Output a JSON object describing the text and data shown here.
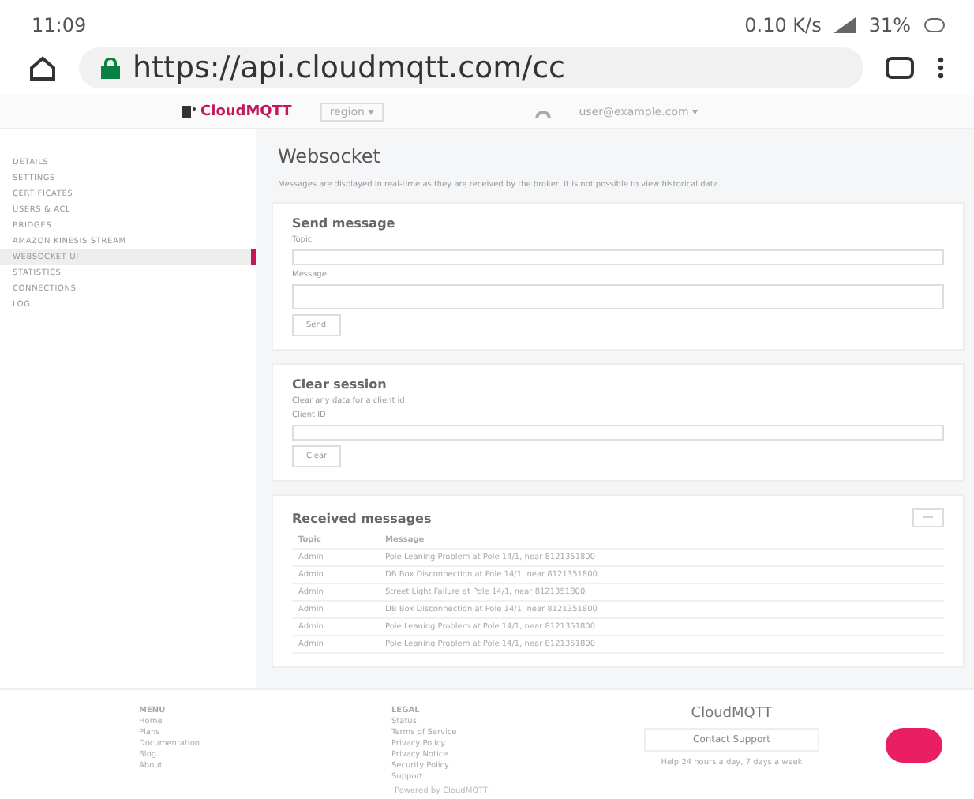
{
  "status_bar": {
    "time": "11:09",
    "speed": "0.10 K/s",
    "battery": "31%"
  },
  "browser": {
    "url": "https://api.cloudmqtt.com/cc",
    "secure": true
  },
  "header": {
    "logo": "CloudMQTT",
    "region": "region ▾",
    "user": "user@example.com ▾"
  },
  "sidebar": {
    "items": [
      {
        "label": "DETAILS",
        "selected": false
      },
      {
        "label": "SETTINGS",
        "selected": false
      },
      {
        "label": "CERTIFICATES",
        "selected": false
      },
      {
        "label": "USERS & ACL",
        "selected": false
      },
      {
        "label": "BRIDGES",
        "selected": false
      },
      {
        "label": "AMAZON KINESIS STREAM",
        "selected": false
      },
      {
        "label": "WEBSOCKET UI",
        "selected": true
      },
      {
        "label": "STATISTICS",
        "selected": false
      },
      {
        "label": "CONNECTIONS",
        "selected": false
      },
      {
        "label": "LOG",
        "selected": false
      }
    ]
  },
  "page": {
    "title": "Websocket",
    "description": "Messages are displayed in real-time as they are received by the broker, it is not possible to view historical data."
  },
  "send_message": {
    "title": "Send message",
    "topic_label": "Topic",
    "message_label": "Message",
    "button": "Send"
  },
  "clear_session": {
    "title": "Clear session",
    "description": "Clear any data for a client id",
    "client_label": "Client ID",
    "button": "Clear"
  },
  "received": {
    "title": "Received messages",
    "toggle": "—",
    "columns": [
      "Topic",
      "Message"
    ],
    "rows": [
      [
        "Admin",
        "Pole Leaning Problem at Pole 14/1, near 8121351800"
      ],
      [
        "Admin",
        "DB Box Disconnection at Pole 14/1, near 8121351800"
      ],
      [
        "Admin",
        "Street Light Failure at Pole 14/1, near 8121351800"
      ],
      [
        "Admin",
        "DB Box Disconnection at Pole 14/1, near 8121351800"
      ],
      [
        "Admin",
        "Pole Leaning Problem at Pole 14/1, near 8121351800"
      ],
      [
        "Admin",
        "Pole Leaning Problem at Pole 14/1, near 8121351800"
      ]
    ]
  },
  "footer": {
    "columns": [
      {
        "title": "MENU",
        "links": [
          "Home",
          "Plans",
          "Documentation",
          "Blog",
          "About"
        ]
      },
      {
        "title": "LEGAL",
        "links": [
          "Status",
          "Terms of Service",
          "Privacy Policy",
          "Privacy Notice",
          "Security Policy",
          "Support"
        ]
      }
    ],
    "brand": "CloudMQTT",
    "contact": "Contact Support",
    "hours": "Help 24 hours a day, 7 days a week",
    "copyright": "Powered by CloudMQTT"
  }
}
